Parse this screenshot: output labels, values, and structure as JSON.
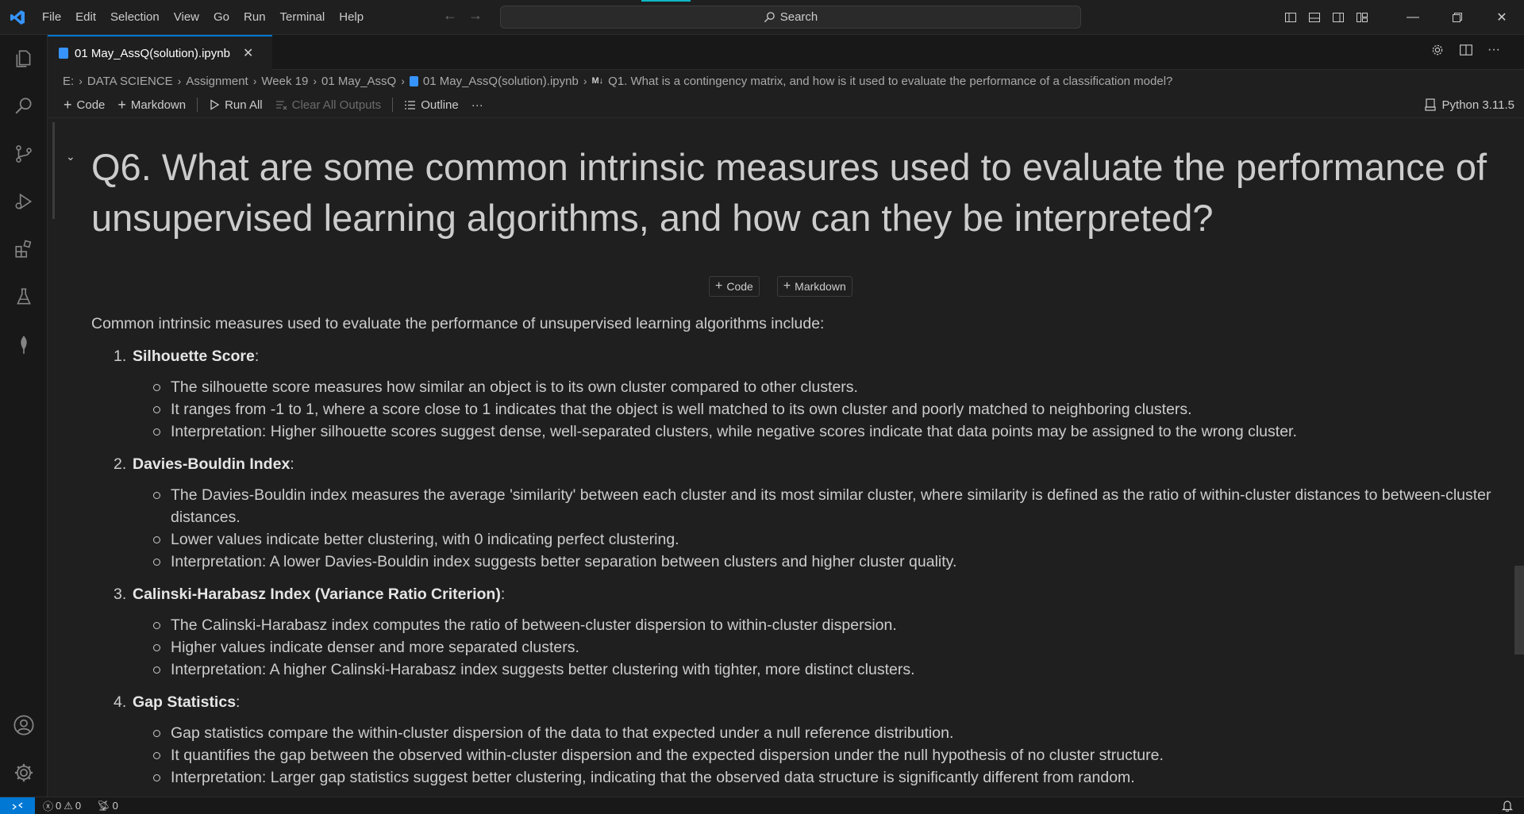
{
  "menu": [
    "File",
    "Edit",
    "Selection",
    "View",
    "Go",
    "Run",
    "Terminal",
    "Help"
  ],
  "search": {
    "label": "Search"
  },
  "tab": {
    "title": "01 May_AssQ(solution).ipynb"
  },
  "breadcrumb": [
    "E:",
    "DATA SCIENCE",
    "Assignment",
    "Week 19",
    "01 May_AssQ",
    "01 May_AssQ(solution).ipynb",
    "Q1. What is a contingency matrix, and how is it used to evaluate the performance of a classification model?"
  ],
  "breadcrumb_md": "M↓",
  "toolbar": {
    "code": "Code",
    "markdown": "Markdown",
    "run_all": "Run All",
    "clear_outputs": "Clear All Outputs",
    "outline": "Outline",
    "more": "···"
  },
  "kernel": "Python 3.11.5",
  "cell": {
    "heading": "Q6. What are some common intrinsic measures used to evaluate the performance of unsupervised learning algorithms, and how can they be interpreted?",
    "insert_code": "Code",
    "insert_markdown": "Markdown",
    "intro": "Common intrinsic measures used to evaluate the performance of unsupervised learning algorithms include:",
    "measures": [
      {
        "num": "1.",
        "title": "Silhouette Score",
        "bullets": [
          "The silhouette score measures how similar an object is to its own cluster compared to other clusters.",
          "It ranges from -1 to 1, where a score close to 1 indicates that the object is well matched to its own cluster and poorly matched to neighboring clusters.",
          "Interpretation: Higher silhouette scores suggest dense, well-separated clusters, while negative scores indicate that data points may be assigned to the wrong cluster."
        ]
      },
      {
        "num": "2.",
        "title": "Davies-Bouldin Index",
        "bullets": [
          "The Davies-Bouldin index measures the average 'similarity' between each cluster and its most similar cluster, where similarity is defined as the ratio of within-cluster distances to between-cluster distances.",
          "Lower values indicate better clustering, with 0 indicating perfect clustering.",
          "Interpretation: A lower Davies-Bouldin index suggests better separation between clusters and higher cluster quality."
        ]
      },
      {
        "num": "3.",
        "title": "Calinski-Harabasz Index (Variance Ratio Criterion)",
        "bullets": [
          "The Calinski-Harabasz index computes the ratio of between-cluster dispersion to within-cluster dispersion.",
          "Higher values indicate denser and more separated clusters.",
          "Interpretation: A higher Calinski-Harabasz index suggests better clustering with tighter, more distinct clusters."
        ]
      },
      {
        "num": "4.",
        "title": "Gap Statistics",
        "bullets": [
          "Gap statistics compare the within-cluster dispersion of the data to that expected under a null reference distribution.",
          "It quantifies the gap between the observed within-cluster dispersion and the expected dispersion under the null hypothesis of no cluster structure.",
          "Interpretation: Larger gap statistics suggest better clustering, indicating that the observed data structure is significantly different from random."
        ]
      }
    ]
  },
  "status": {
    "errors": "0",
    "warnings": "0",
    "ports": "0"
  },
  "colors": {
    "accent": "#0078d4",
    "bg": "#1f1f1f",
    "text": "#cccccc"
  }
}
